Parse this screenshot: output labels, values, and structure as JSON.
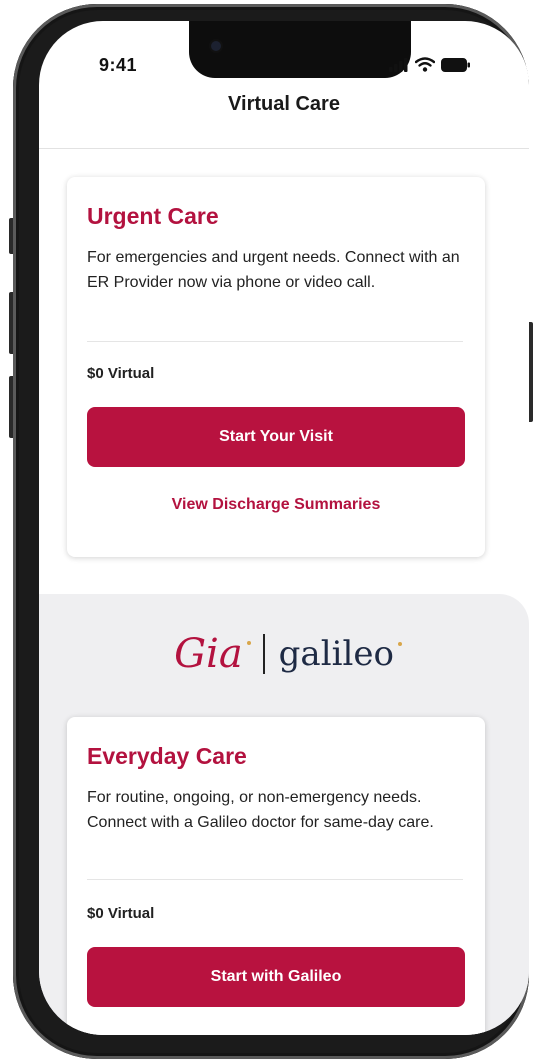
{
  "status_bar": {
    "time": "9:41",
    "signal_icon": "signal-bars-icon",
    "wifi_icon": "wifi-icon",
    "battery_icon": "battery-icon"
  },
  "header": {
    "title": "Virtual Care"
  },
  "urgent_card": {
    "title": "Urgent Care",
    "description": "For emergencies and urgent needs. Connect with an ER Provider now via phone or video call.",
    "price": "$0 Virtual",
    "primary_button": "Start Your Visit",
    "link": "View Discharge Summaries"
  },
  "partner_logo": {
    "gia": "Gia",
    "galileo": "galileo"
  },
  "everyday_card": {
    "title": "Everyday Care",
    "description": "For routine, ongoing, or non-emergency needs. Connect with a Galileo doctor for same-day care.",
    "price": "$0 Virtual",
    "primary_button": "Start with Galileo"
  },
  "colors": {
    "brand": "#b8123f",
    "panel": "#efeff1",
    "galileo_navy": "#1e2a44",
    "accent_gold": "#d8a64a"
  }
}
